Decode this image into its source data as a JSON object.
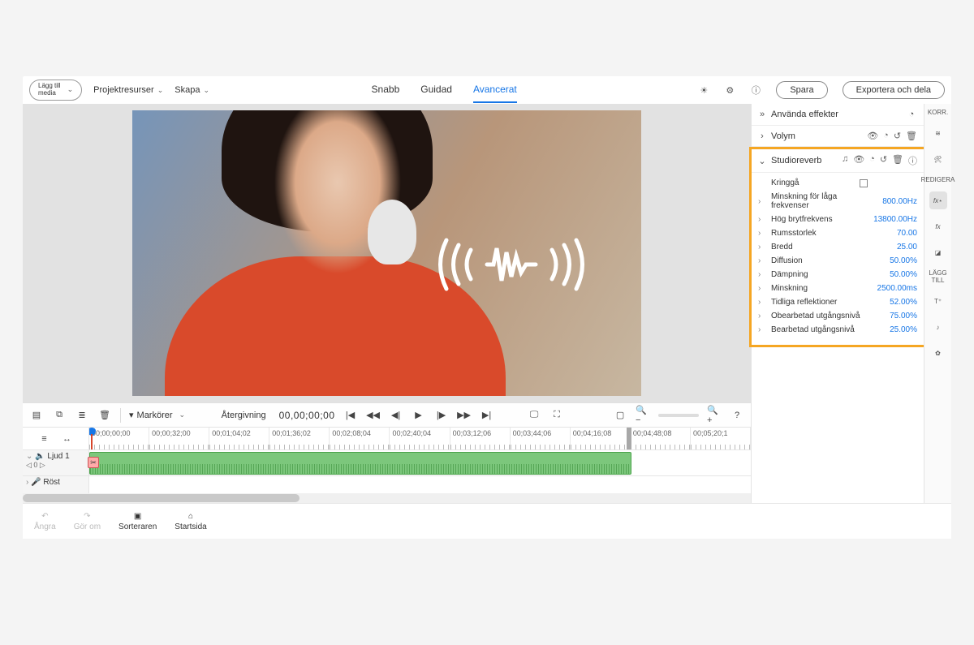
{
  "topbar": {
    "addMedia_l1": "Lägg till",
    "addMedia_l2": "media",
    "menu": {
      "project": "Projektresurser",
      "create": "Skapa"
    },
    "tabs": {
      "quick": "Snabb",
      "guided": "Guidad",
      "advanced": "Avancerat"
    },
    "save": "Spara",
    "export": "Exportera och dela"
  },
  "panel": {
    "heading": "Använda effekter",
    "volume": "Volym",
    "studioreverb": "Studioreverb"
  },
  "params": [
    {
      "name": "Kringgå",
      "value": "",
      "checkbox": true
    },
    {
      "name": "Minskning för låga frekvenser",
      "value": "800.00Hz"
    },
    {
      "name": "Hög brytfrekvens",
      "value": "13800.00Hz"
    },
    {
      "name": "Rumsstorlek",
      "value": "70.00"
    },
    {
      "name": "Bredd",
      "value": "25.00"
    },
    {
      "name": "Diffusion",
      "value": "50.00%"
    },
    {
      "name": "Dämpning",
      "value": "50.00%"
    },
    {
      "name": "Minskning",
      "value": "2500.00ms"
    },
    {
      "name": "Tidliga reflektioner",
      "value": "52.00%"
    },
    {
      "name": "Obearbetad utgångsnivå",
      "value": "75.00%"
    },
    {
      "name": "Bearbetad utgångsnivå",
      "value": "25.00%"
    }
  ],
  "rail": {
    "korr": "KORR.",
    "redigera": "REDIGERA",
    "laggtill": "LÄGG TILL"
  },
  "transport": {
    "markers": "Markörer",
    "render": "Återgivning",
    "timecode": "00,00;00;00"
  },
  "ruler": [
    "00;00;00;00",
    "00;00;32;00",
    "00;01;04;02",
    "00;01;36;02",
    "00;02;08;04",
    "00;02;40;04",
    "00;03;12;06",
    "00;03;44;06",
    "00;04;16;08",
    "00;04;48;08",
    "00;05;20;1"
  ],
  "tracks": {
    "audio1": "Ljud 1",
    "audio1sub": "◁ 0  ▷",
    "voice": "Röst"
  },
  "bottom": {
    "undo": "Ångra",
    "redo": "Gör om",
    "organizer": "Sorteraren",
    "home": "Startsida"
  }
}
